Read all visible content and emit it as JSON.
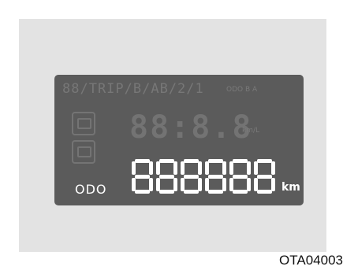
{
  "display": {
    "top_row_text": "88/TRIP/B/AB/2/1",
    "top_row_small": "ODO B A",
    "mid_digits": "88:8.8",
    "mid_unit": "km/L",
    "odometer": {
      "label": "ODO",
      "digits": "888888",
      "unit": "km"
    }
  },
  "caption": {
    "image_code": "OTA04003"
  },
  "colors": {
    "lcd_background": "#5b5b5b",
    "lit_segment": "#ffffff",
    "unlit_segment": "#737373",
    "frame": "#e3e3e3"
  }
}
